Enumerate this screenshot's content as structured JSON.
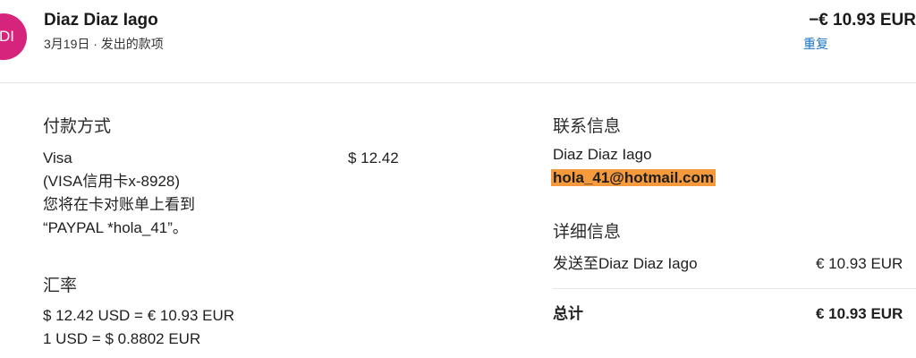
{
  "header": {
    "avatar_initials": "DI",
    "merchant": "Diaz Diaz Iago",
    "subline": "3月19日 · 发出的款项",
    "amount": "−€ 10.93 EUR",
    "repeat_label": "重复"
  },
  "payment_method": {
    "title": "付款方式",
    "card_name": "Visa",
    "card_detail": "(VISA信用卡x-8928)",
    "statement_note_line1": "您将在卡对账单上看到",
    "statement_note_line2": "“PAYPAL *hola_41”。",
    "amount": "$ 12.42"
  },
  "exchange_rate": {
    "title": "汇率",
    "line1": "$ 12.42 USD = € 10.93 EUR",
    "line2": "1 USD = $ 0.8802 EUR"
  },
  "contact": {
    "title": "联系信息",
    "name": "Diaz Diaz Iago",
    "email": "hola_41@hotmail.com"
  },
  "details": {
    "title": "详细信息",
    "sent_to_label": "发送至Diaz Diaz Iago",
    "sent_to_amount": "€ 10.93 EUR",
    "total_label": "总计",
    "total_amount": "€ 10.93 EUR"
  },
  "colors": {
    "avatar": "#d6247d",
    "link": "#1a73c7",
    "highlight": "#f59a3c"
  }
}
